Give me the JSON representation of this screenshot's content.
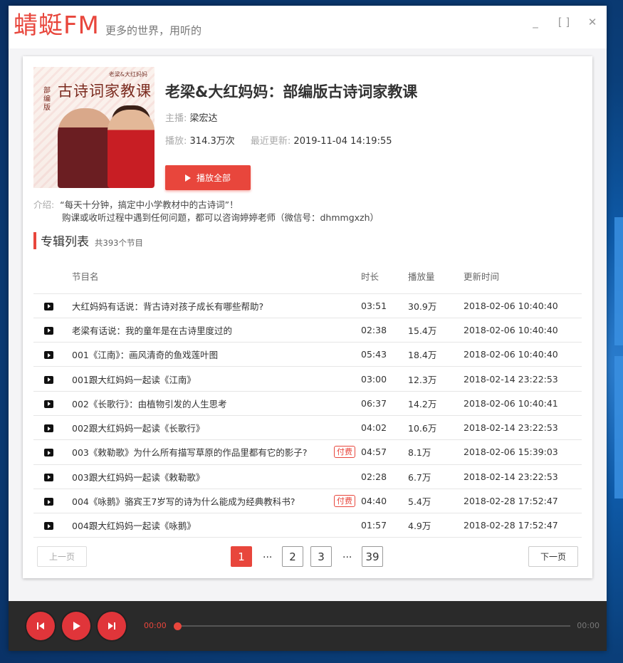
{
  "app": {
    "logo": "蜻蜓FM",
    "slogan": "更多的世界，用听的",
    "controls": {
      "minimize": "_",
      "maximize": "[ ]",
      "close": "✕"
    }
  },
  "album": {
    "cover": {
      "caption": "老梁&大红妈妈",
      "title": "古诗词家教课",
      "side": "部编版"
    },
    "title": "老梁&大红妈妈：部编版古诗词家教课",
    "host_label": "主播:",
    "host": "梁宏达",
    "plays_label": "播放:",
    "plays": "314.3万次",
    "updated_label": "最近更新:",
    "updated": "2019-11-04 14:19:55",
    "play_all": "播放全部",
    "intro_label": "介绍:",
    "intro_line1": "“每天十分钟，搞定中小学教材中的古诗词”！",
    "intro_line2": "购课或收听过程中遇到任何问题，都可以咨询婷婷老师（微信号：dhmmgxzh）"
  },
  "list": {
    "title": "专辑列表",
    "count": "共393个节目",
    "headers": {
      "name": "节目名",
      "duration": "时长",
      "plays": "播放量",
      "updated": "更新时间"
    },
    "paid_label": "付费",
    "rows": [
      {
        "name": "大红妈妈有话说：背古诗对孩子成长有哪些帮助?",
        "paid": false,
        "duration": "03:51",
        "plays": "30.9万",
        "updated": "2018-02-06 10:40:40"
      },
      {
        "name": "老梁有话说：我的童年是在古诗里度过的",
        "paid": false,
        "duration": "02:38",
        "plays": "15.4万",
        "updated": "2018-02-06 10:40:40"
      },
      {
        "name": "001《江南》：画风清奇的鱼戏莲叶图",
        "paid": false,
        "duration": "05:43",
        "plays": "18.4万",
        "updated": "2018-02-06 10:40:40"
      },
      {
        "name": "001跟大红妈妈一起读《江南》",
        "paid": false,
        "duration": "03:00",
        "plays": "12.3万",
        "updated": "2018-02-14 23:22:53"
      },
      {
        "name": "002《长歌行》：由植物引发的人生思考",
        "paid": false,
        "duration": "06:37",
        "plays": "14.2万",
        "updated": "2018-02-06 10:40:41"
      },
      {
        "name": "002跟大红妈妈一起读《长歌行》",
        "paid": false,
        "duration": "04:02",
        "plays": "10.6万",
        "updated": "2018-02-14 23:22:53"
      },
      {
        "name": "003《敕勒歌》为什么所有描写草原的作品里都有它的影子?",
        "paid": true,
        "duration": "04:57",
        "plays": "8.1万",
        "updated": "2018-02-06 15:39:03"
      },
      {
        "name": "003跟大红妈妈一起读《敕勒歌》",
        "paid": false,
        "duration": "02:28",
        "plays": "6.7万",
        "updated": "2018-02-14 23:22:53"
      },
      {
        "name": "004《咏鹅》骆宾王7岁写的诗为什么能成为经典教科书?",
        "paid": true,
        "duration": "04:40",
        "plays": "5.4万",
        "updated": "2018-02-28 17:52:47"
      },
      {
        "name": "004跟大红妈妈一起读《咏鹅》",
        "paid": false,
        "duration": "01:57",
        "plays": "4.9万",
        "updated": "2018-02-28 17:52:47"
      }
    ]
  },
  "pager": {
    "prev": "上一页",
    "next": "下一页",
    "pages": [
      "1",
      "2",
      "3",
      "39"
    ],
    "dots": "...",
    "current": "1"
  },
  "player": {
    "current_time": "00:00",
    "total_time": "00:00",
    "progress": 0,
    "accent": "#e8463c"
  }
}
